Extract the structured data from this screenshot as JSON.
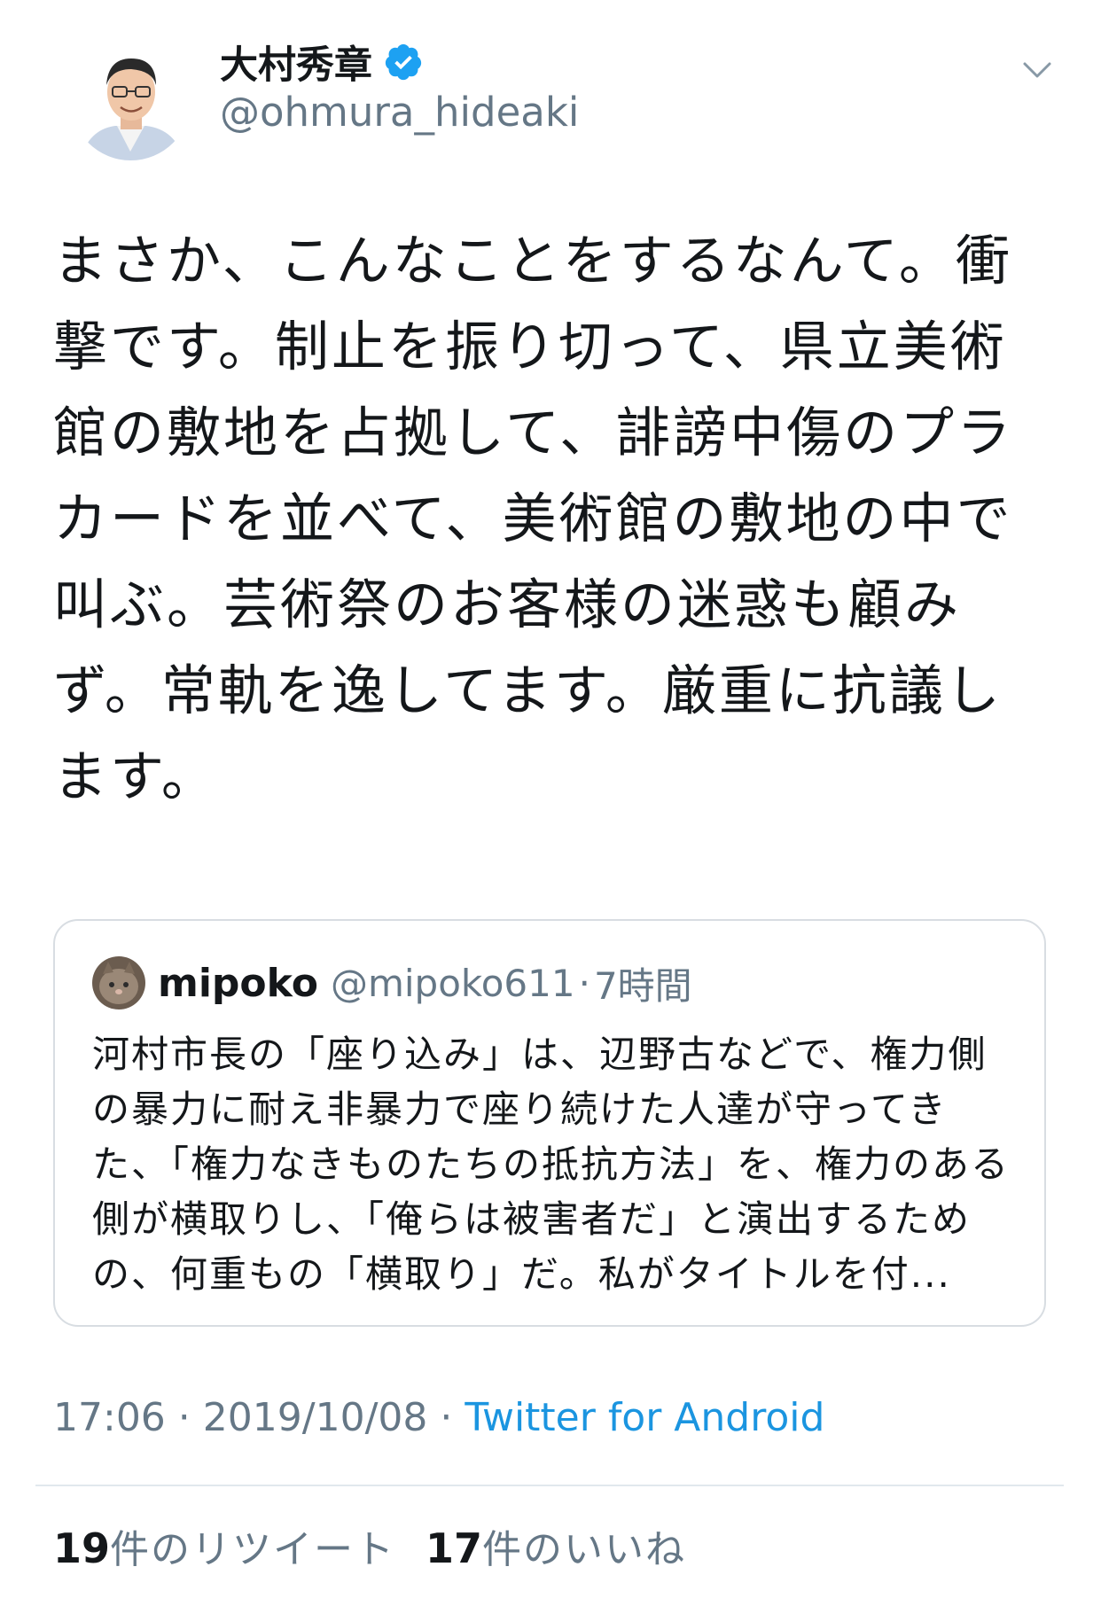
{
  "author": {
    "display_name": "大村秀章",
    "handle": "@ohmura_hideaki",
    "verified": true
  },
  "icons": {
    "verified": "verified-badge-icon",
    "menu": "chevron-down-icon"
  },
  "tweet": {
    "text": "まさか、こんなことをするなんて。衝撃です。制止を振り切って、県立美術館の敷地を占拠して、誹謗中傷のプラカードを並べて、美術館の敷地の中で叫ぶ。芸術祭のお客様の迷惑も顧みず。常軌を逸してます。厳重に抗議します。"
  },
  "quote": {
    "name": "mipoko",
    "handle": "@mipoko611",
    "separator": "·",
    "time": "7時間",
    "text": "河村市長の「座り込み」は、辺野古などで、権力側の暴力に耐え非暴力で座り続けた人達が守ってきた、「権力なきものたちの抵抗方法」を、権力のある側が横取りし、「俺らは被害者だ」と演出するための、何重もの「横取り」だ。私がタイトルを付..."
  },
  "meta": {
    "time": "17:06",
    "separator": " · ",
    "date": "2019/10/08",
    "separator2": " · ",
    "source": "Twitter for Android"
  },
  "stats": {
    "retweets_count": "19",
    "retweets_label": "件のリツイート",
    "likes_count": "17",
    "likes_label": "件のいいね"
  },
  "colors": {
    "text": "#14171a",
    "secondary": "#657786",
    "link": "#1b95e0",
    "verified": "#1da1f2",
    "border": "#d8dde2"
  }
}
